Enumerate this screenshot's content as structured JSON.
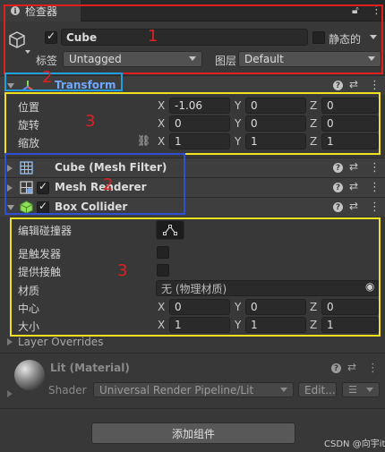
{
  "tab": {
    "title": "检查器"
  },
  "object": {
    "name": "Cube",
    "static_label": "静态的",
    "tag_label": "标签",
    "tag_value": "Untagged",
    "layer_label": "图层",
    "layer_value": "Default"
  },
  "transform": {
    "title": "Transform",
    "rows": [
      {
        "label": "位置",
        "x": "-1.06",
        "y": "0",
        "z": "0"
      },
      {
        "label": "旋转",
        "x": "0",
        "y": "0",
        "z": "0"
      },
      {
        "label": "缩放",
        "x": "1",
        "y": "1",
        "z": "1"
      }
    ]
  },
  "axes": {
    "x": "X",
    "y": "Y",
    "z": "Z"
  },
  "components": {
    "mesh_filter": "Cube (Mesh Filter)",
    "mesh_renderer": "Mesh Renderer",
    "box_collider": "Box Collider"
  },
  "collider": {
    "edit_label": "编辑碰撞器",
    "trigger_label": "是触发器",
    "contacts_label": "提供接触",
    "material_label": "材质",
    "material_value": "无 (物理材质)",
    "center_label": "中心",
    "center": {
      "x": "0",
      "y": "0",
      "z": "0"
    },
    "size_label": "大小",
    "size": {
      "x": "1",
      "y": "1",
      "z": "1"
    }
  },
  "layer_overrides": "Layer Overrides",
  "material": {
    "title": "Lit (Material)",
    "shader_label": "Shader",
    "shader_value": "Universal Render Pipeline/Lit",
    "edit_label": "Edit...",
    "list_icon": "list-icon"
  },
  "add_component": "添加组件",
  "watermark": "CSDN @向宇it",
  "annotations": {
    "a1": "1",
    "a2a": "2",
    "a2b": "2",
    "a3a": "3",
    "a3b": "3"
  },
  "colors": {
    "red": "#e02020",
    "cyan": "#1ea0e0",
    "yellow": "#f0e020",
    "blue": "#2f50d0",
    "transform_title": "#6fa8ff"
  }
}
